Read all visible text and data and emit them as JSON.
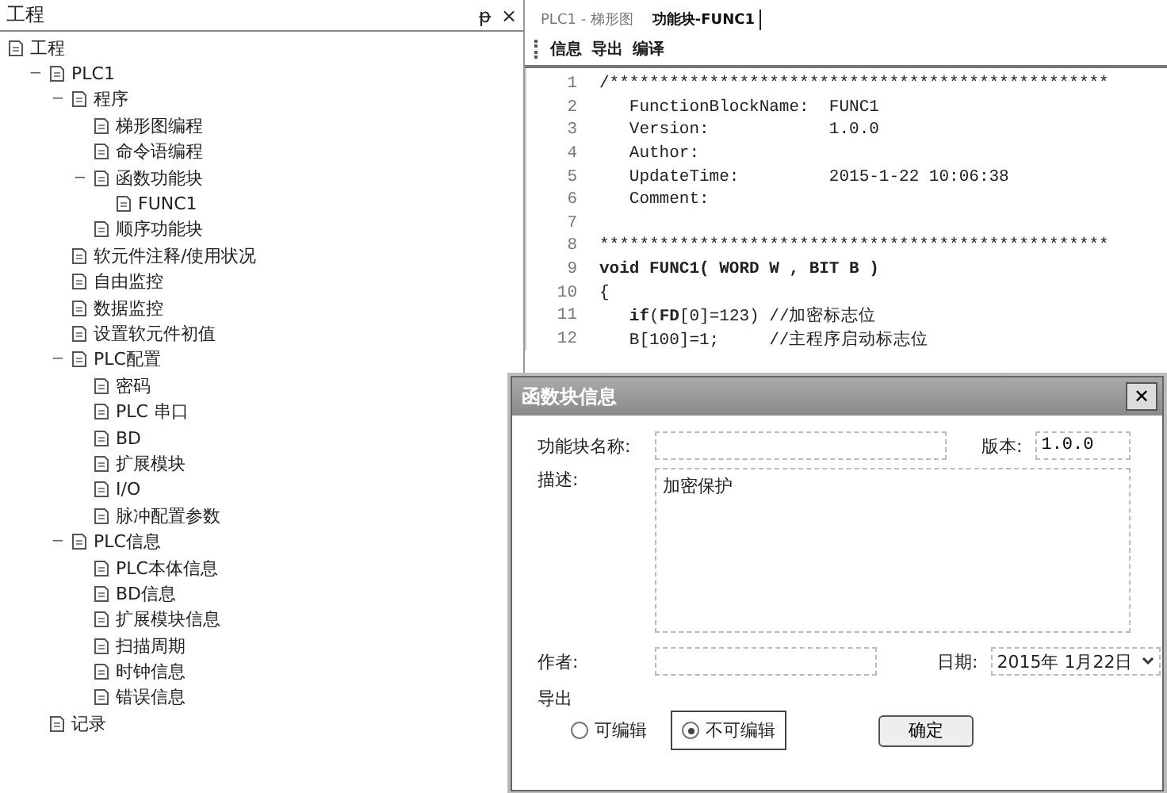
{
  "left_panel": {
    "title": "工程",
    "pin": "ᵽ",
    "close": "×",
    "tree": [
      {
        "label": "工程",
        "children": [
          {
            "label": "PLC1",
            "toggle": "−",
            "children": [
              {
                "label": "程序",
                "toggle": "−",
                "children": [
                  {
                    "label": "梯形图编程"
                  },
                  {
                    "label": "命令语编程"
                  },
                  {
                    "label": "函数功能块",
                    "toggle": "−",
                    "children": [
                      {
                        "label": "FUNC1"
                      }
                    ]
                  },
                  {
                    "label": "顺序功能块"
                  }
                ]
              },
              {
                "label": "软元件注释/使用状况"
              },
              {
                "label": "自由监控"
              },
              {
                "label": "数据监控"
              },
              {
                "label": "设置软元件初值"
              },
              {
                "label": "PLC配置",
                "toggle": "−",
                "children": [
                  {
                    "label": "密码"
                  },
                  {
                    "label": "PLC 串口"
                  },
                  {
                    "label": "BD"
                  },
                  {
                    "label": "扩展模块"
                  },
                  {
                    "label": "I/O"
                  },
                  {
                    "label": "脉冲配置参数"
                  }
                ]
              },
              {
                "label": "PLC信息",
                "toggle": "−",
                "children": [
                  {
                    "label": "PLC本体信息"
                  },
                  {
                    "label": "BD信息"
                  },
                  {
                    "label": "扩展模块信息"
                  },
                  {
                    "label": "扫描周期"
                  },
                  {
                    "label": "时钟信息"
                  },
                  {
                    "label": "错误信息"
                  }
                ]
              }
            ]
          },
          {
            "label": "记录"
          }
        ]
      }
    ]
  },
  "editor": {
    "tabs": [
      {
        "label": "PLC1 - 梯形图",
        "selected": false
      },
      {
        "label": "功能块-FUNC1",
        "selected": true
      }
    ],
    "toolbar": [
      "信息",
      "导出",
      "编译"
    ],
    "lines": [
      {
        "number": "1",
        "kind": "plain",
        "text": "/**************************************************"
      },
      {
        "number": "2",
        "text": "   FunctionBlockName:  FUNC1"
      },
      {
        "number": "3",
        "text": "   Version:            1.0.0"
      },
      {
        "number": "4",
        "text": "   Author:"
      },
      {
        "number": "5",
        "text": "   UpdateTime:         2015-1-22 10:06:38"
      },
      {
        "number": "6",
        "text": "   Comment:"
      },
      {
        "number": "7"
      },
      {
        "number": "8",
        "kind": "plain",
        "text": "***************************************************"
      },
      {
        "number": "9",
        "kind": "markup",
        "text": "**void FUNC1( WORD W , BIT B )**"
      },
      {
        "number": "10",
        "text": "{"
      },
      {
        "number": "11",
        "kind": "markup",
        "text": "   **if**(**FD**[0]=123) //加密标志位"
      },
      {
        "number": "12",
        "text": "   B[100]=1;     //主程序启动标志位"
      }
    ]
  },
  "dialog": {
    "title": "函数块信息",
    "close": "✕",
    "name_label": "功能块名称:",
    "version_label": "版本:",
    "version": "1.0.0",
    "description_label": "描述:",
    "description": "加密保护",
    "author_label": "作者:",
    "date_label": "日期:",
    "date": "2015年 1月22日",
    "export_label": "导出",
    "radios": [
      {
        "label": "可编辑",
        "selected": false
      },
      {
        "label": "不可编辑",
        "selected": true
      }
    ],
    "ok": "确定"
  }
}
